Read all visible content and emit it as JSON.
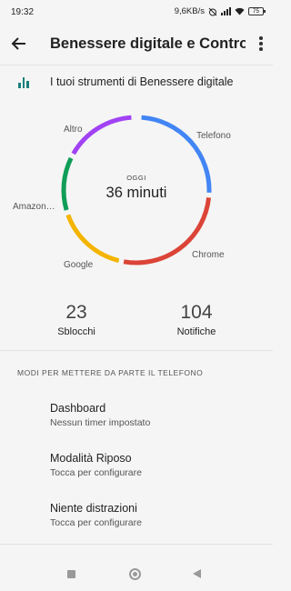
{
  "status": {
    "time": "19:32",
    "speed": "9,6KB/s",
    "battery": "75"
  },
  "app_bar": {
    "title": "Benessere digitale e Controll…",
    "back_icon": "back-arrow-icon",
    "more_icon": "more-vert-icon"
  },
  "tools": {
    "label": "I tuoi strumenti di Benessere digitale",
    "icon": "bar-chart-icon"
  },
  "donut": {
    "caption": "OGGI",
    "total": "36 minuti",
    "segments": [
      {
        "label": "Telefono",
        "color": "#4285f4"
      },
      {
        "label": "Chrome",
        "color": "#db4437"
      },
      {
        "label": "Google",
        "color": "#f4b400"
      },
      {
        "label": "Amazon…",
        "color": "#0f9d58"
      },
      {
        "label": "Altro",
        "color": "#a142f4"
      }
    ]
  },
  "stats": {
    "unlocks_value": "23",
    "unlocks_label": "Sblocchi",
    "notifications_value": "104",
    "notifications_label": "Notifiche"
  },
  "section": {
    "header": "MODI PER METTERE DA PARTE IL TELEFONO"
  },
  "settings": [
    {
      "title": "Dashboard",
      "subtitle": "Nessun timer impostato"
    },
    {
      "title": "Modalità Riposo",
      "subtitle": "Tocca per configurare"
    },
    {
      "title": "Niente distrazioni",
      "subtitle": "Tocca per configurare"
    }
  ],
  "nav": {
    "recents_icon": "square-recents-icon",
    "home_icon": "circle-home-icon",
    "back_icon": "triangle-back-icon"
  }
}
